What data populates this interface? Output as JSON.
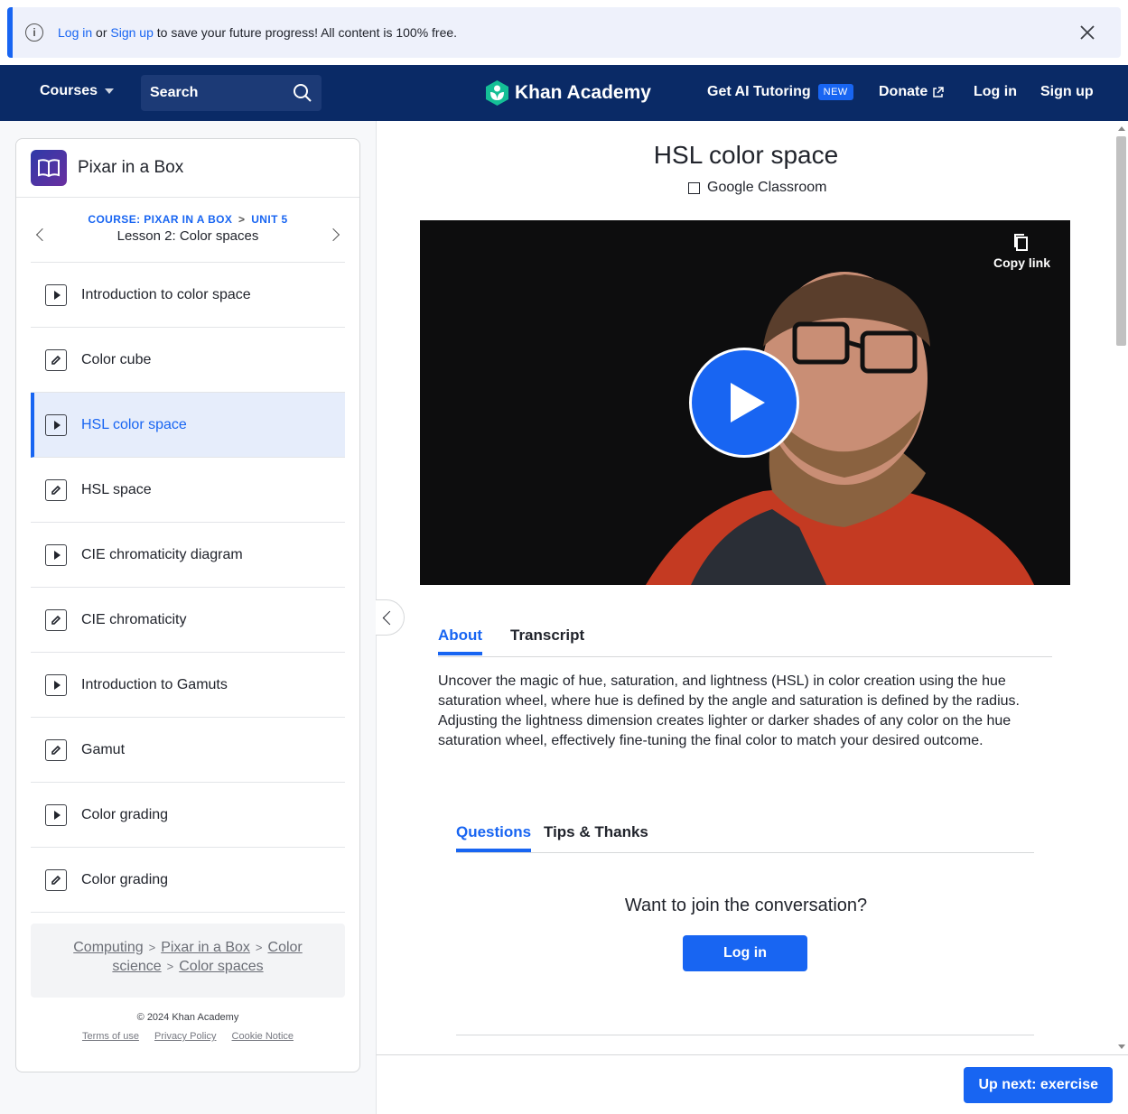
{
  "banner": {
    "login_link": "Log in",
    "or_text": " or ",
    "signup_link": "Sign up",
    "message": " to save your future progress! All content is 100% free."
  },
  "header": {
    "courses": "Courses",
    "search_label": "Search",
    "logo_text": "Khan Academy",
    "ai_tutoring": "Get AI Tutoring",
    "new_badge": "NEW",
    "donate": "Donate",
    "login": "Log in",
    "signup": "Sign up",
    "bg_color": "#0a2a66"
  },
  "sidebar": {
    "course_title": "Pixar in a Box",
    "crumb_course": "COURSE: PIXAR IN A BOX",
    "crumb_sep": ">",
    "crumb_unit": "UNIT 5",
    "lesson_title": "Lesson 2: Color spaces",
    "items": [
      {
        "label": "Introduction to color space",
        "type": "video",
        "active": false
      },
      {
        "label": "Color cube",
        "type": "exercise",
        "active": false
      },
      {
        "label": "HSL color space",
        "type": "video",
        "active": true
      },
      {
        "label": "HSL space",
        "type": "exercise",
        "active": false
      },
      {
        "label": "CIE chromaticity diagram",
        "type": "video",
        "active": false
      },
      {
        "label": "CIE chromaticity",
        "type": "exercise",
        "active": false
      },
      {
        "label": "Introduction to Gamuts",
        "type": "video",
        "active": false
      },
      {
        "label": "Gamut",
        "type": "exercise",
        "active": false
      },
      {
        "label": "Color grading",
        "type": "video",
        "active": false
      },
      {
        "label": "Color grading",
        "type": "exercise",
        "active": false
      }
    ],
    "breadcrumbs": {
      "computing": "Computing",
      "pixar": "Pixar in a Box",
      "color_science_1": "Color",
      "color_science_2": "science",
      "color_spaces": "Color spaces",
      "sep": ">"
    },
    "footer": {
      "copyright": "© 2024 Khan Academy",
      "terms": "Terms of use",
      "privacy": "Privacy Policy",
      "cookie": "Cookie Notice"
    }
  },
  "main": {
    "title": "HSL color space",
    "google_classroom": "Google Classroom",
    "copy_link": "Copy link",
    "tabs": {
      "about": "About",
      "transcript": "Transcript"
    },
    "description": "Uncover the magic of hue, saturation, and lightness (HSL) in color creation using the hue saturation wheel, where hue is defined by the angle and saturation is defined by the radius. Adjusting the lightness dimension creates lighter or darker shades of any color on the hue saturation wheel, effectively fine-tuning the final color to match your desired outcome.",
    "discussion_tabs": {
      "questions": "Questions",
      "tips": "Tips & Thanks"
    },
    "conversation": "Want to join the conversation?",
    "login_button": "Log in",
    "up_next": "Up next: exercise",
    "accent_color": "#1865f2"
  }
}
